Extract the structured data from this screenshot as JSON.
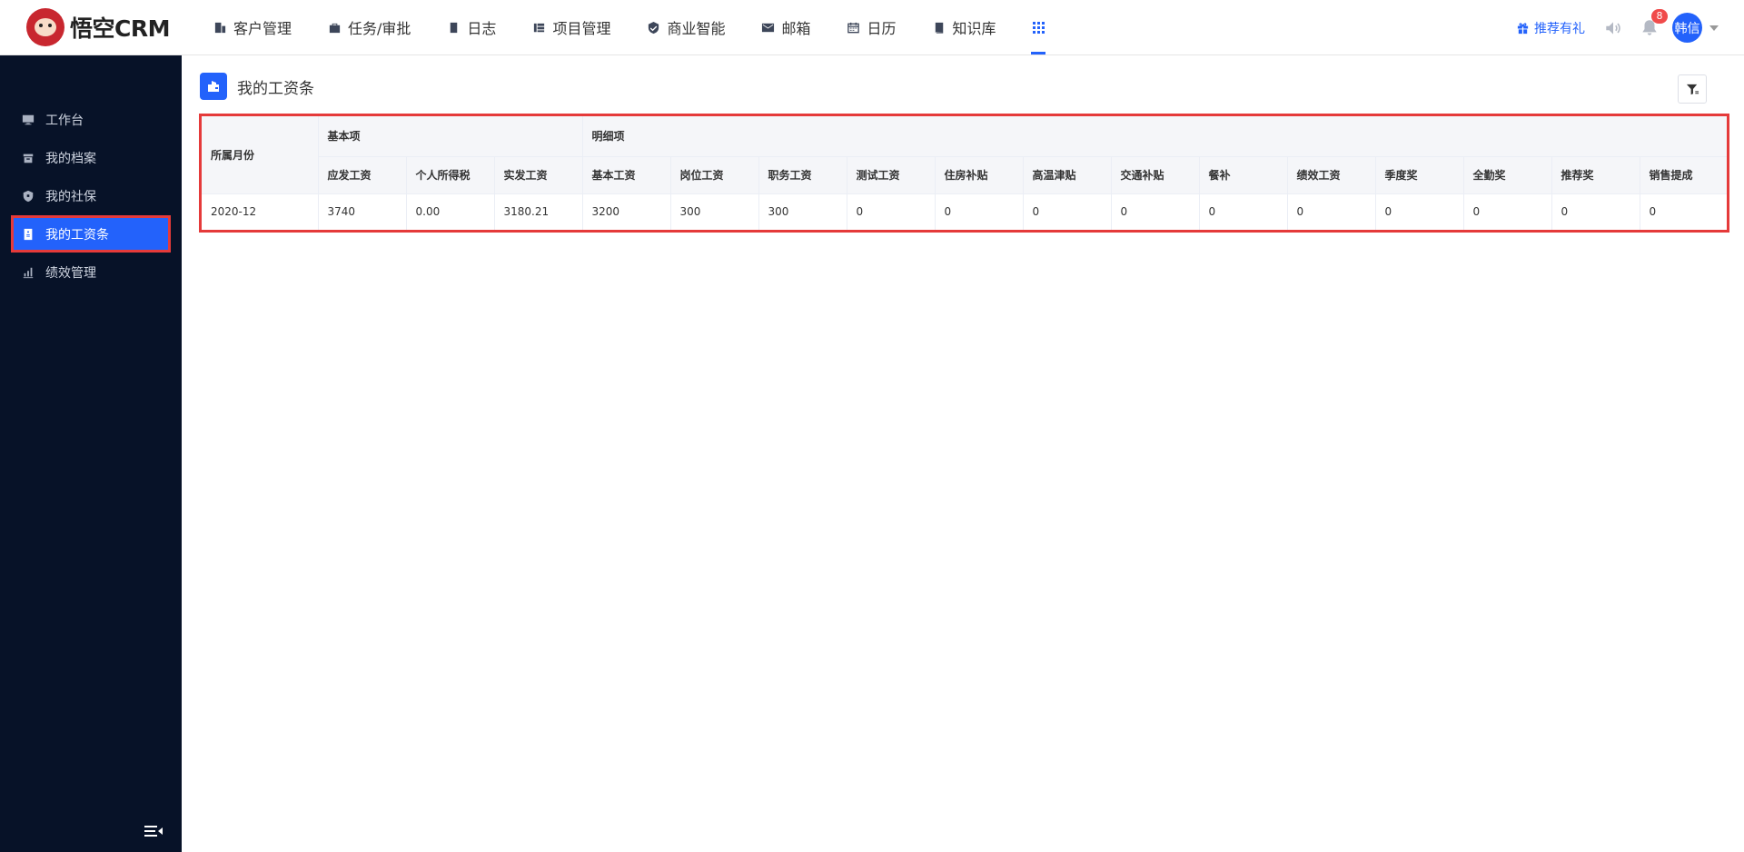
{
  "brand": {
    "name": "悟空CRM"
  },
  "nav": [
    {
      "label": "客户管理",
      "icon": "building-icon"
    },
    {
      "label": "任务/审批",
      "icon": "briefcase-icon"
    },
    {
      "label": "日志",
      "icon": "notebook-icon"
    },
    {
      "label": "项目管理",
      "icon": "project-icon"
    },
    {
      "label": "商业智能",
      "icon": "shield-check-icon"
    },
    {
      "label": "邮箱",
      "icon": "mail-icon"
    },
    {
      "label": "日历",
      "icon": "calendar-icon"
    },
    {
      "label": "知识库",
      "icon": "book-icon"
    }
  ],
  "header": {
    "gift_label": "推荐有礼",
    "notification_count": "8",
    "user_name": "韩信"
  },
  "sidebar": {
    "items": [
      {
        "label": "工作台",
        "icon": "monitor-icon"
      },
      {
        "label": "我的档案",
        "icon": "archive-icon"
      },
      {
        "label": "我的社保",
        "icon": "shield-icon"
      },
      {
        "label": "我的工资条",
        "icon": "payslip-icon"
      },
      {
        "label": "绩效管理",
        "icon": "bar-chart-icon"
      }
    ],
    "active_index": 3
  },
  "page": {
    "title": "我的工资条"
  },
  "table": {
    "month_header": "所属月份",
    "group_basic": "基本项",
    "group_detail": "明细项",
    "basic_columns": [
      "应发工资",
      "个人所得税",
      "实发工资"
    ],
    "detail_columns": [
      "基本工资",
      "岗位工资",
      "职务工资",
      "测试工资",
      "住房补贴",
      "高温津贴",
      "交通补贴",
      "餐补",
      "绩效工资",
      "季度奖",
      "全勤奖",
      "推荐奖",
      "销售提成"
    ],
    "rows": [
      {
        "month": "2020-12",
        "basic": [
          "3740",
          "0.00",
          "3180.21"
        ],
        "detail": [
          "3200",
          "300",
          "300",
          "0",
          "0",
          "0",
          "0",
          "0",
          "0",
          "0",
          "0",
          "0",
          "0"
        ]
      }
    ]
  },
  "colors": {
    "accent": "#2362fb",
    "sidebar_bg": "#071228",
    "highlight_border": "#e53a3a",
    "badge": "#f04b4b"
  }
}
